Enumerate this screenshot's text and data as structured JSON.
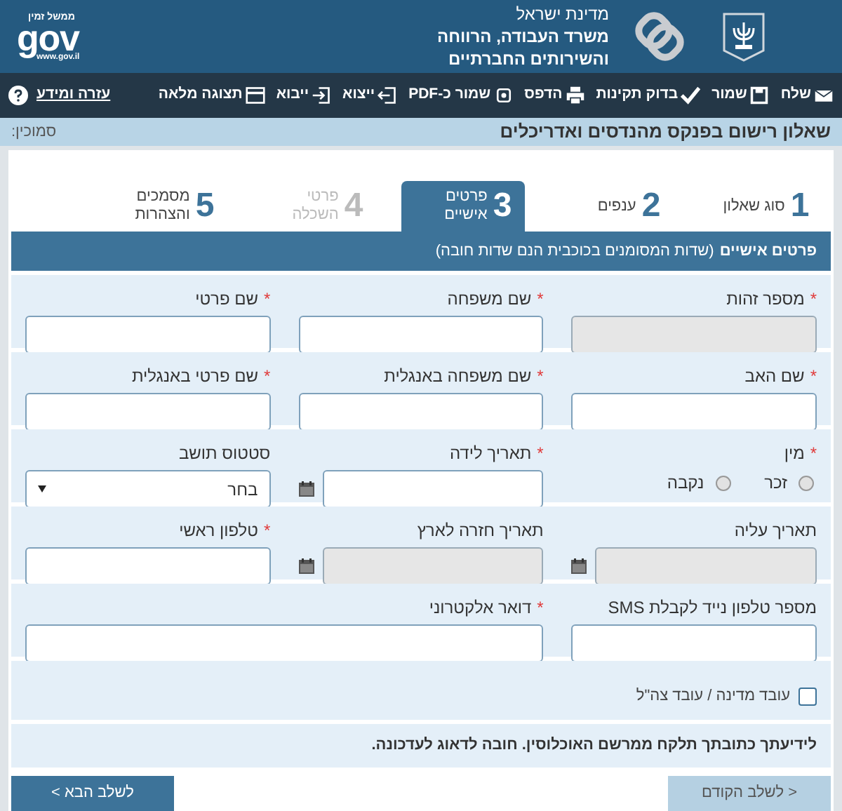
{
  "header": {
    "state": "מדינת ישראל",
    "ministry_line_1": "משרד העבודה, הרווחה",
    "ministry_line_2": "והשירותים החברתיים",
    "gov_tagline": "ממשל זמין",
    "gov_logo": "gov",
    "gov_url": "www.gov.il"
  },
  "toolbar": [
    {
      "label": "שלח"
    },
    {
      "label": "שמור"
    },
    {
      "label": "בדוק תקינות"
    },
    {
      "label": "הדפס"
    },
    {
      "label": "שמור כ-PDF"
    },
    {
      "label": "ייצוא"
    },
    {
      "label": "ייבוא"
    },
    {
      "label": "תצוגה מלאה"
    }
  ],
  "help_link": "עזרה ומידע",
  "form_title": "שאלון רישום בפנקס מהנדסים ואדריכלים",
  "reference_label": "סמוכין:",
  "steps": [
    {
      "number": "1",
      "label": "סוג שאלון",
      "selected": false,
      "disabled": false
    },
    {
      "number": "2",
      "label": "ענפים",
      "selected": false,
      "disabled": false
    },
    {
      "number": "3",
      "label": "פרטים אישיים",
      "selected": true,
      "disabled": false
    },
    {
      "number": "4",
      "label": "פרטי השכלה",
      "selected": false,
      "disabled": true
    },
    {
      "number": "5",
      "label": "מסמכים והצהרות",
      "selected": false,
      "disabled": false
    }
  ],
  "section": {
    "title": "פרטים אישיים",
    "note": "(שדות המסומנים בכוכבית הנם שדות חובה)"
  },
  "rows": [
    {
      "fields": [
        {
          "kind": "text",
          "label": "מספר זהות",
          "required_mark": "*",
          "disabled": true
        },
        {
          "kind": "text",
          "label": "שם משפחה",
          "required_mark": "*",
          "disabled": false
        },
        {
          "kind": "text",
          "label": "שם פרטי",
          "required_mark": "*",
          "disabled": false
        }
      ]
    },
    {
      "fields": [
        {
          "kind": "text",
          "label": "שם האב",
          "required_mark": "*",
          "disabled": false
        },
        {
          "kind": "text",
          "label": "שם משפחה באנגלית",
          "required_mark": "*",
          "disabled": false
        },
        {
          "kind": "text",
          "label": "שם פרטי באנגלית",
          "required_mark": "*",
          "disabled": false
        }
      ]
    },
    {
      "fields": [
        {
          "kind": "radio",
          "label": "מין",
          "required_mark": "*",
          "options": [
            {
              "label": "זכר",
              "selected": false
            },
            {
              "label": "נקבה",
              "selected": false
            }
          ]
        },
        {
          "kind": "date",
          "label": "תאריך לידה",
          "required_mark": "*",
          "disabled": false
        },
        {
          "kind": "select",
          "label": "סטטוס תושב",
          "value": "בחר"
        }
      ]
    },
    {
      "fields": [
        {
          "kind": "date",
          "label": "תאריך עליה",
          "disabled": true
        },
        {
          "kind": "date",
          "label": "תאריך חזרה לארץ",
          "disabled": true
        },
        {
          "kind": "text",
          "label": "טלפון ראשי",
          "required_mark": "*",
          "disabled": false
        }
      ]
    },
    {
      "fields": [
        {
          "kind": "text",
          "label": "מספר טלפון נייד לקבלת SMS",
          "disabled": false
        },
        {
          "kind": "wide",
          "label": "דואר אלקטרוני",
          "required_mark": "*",
          "disabled": false
        }
      ]
    }
  ],
  "checkbox": {
    "label": "עובד מדינה / עובד צה\"ל",
    "checked": false
  },
  "notice": "לידיעתך כתובתך תלקח ממרשם האוכלוסין. חובה לדאוג לעדכונה.",
  "buttons": [
    {
      "label": "< לשלב הקודם",
      "disabled": true
    },
    {
      "label": "לשלב הבא >",
      "disabled": false
    }
  ]
}
